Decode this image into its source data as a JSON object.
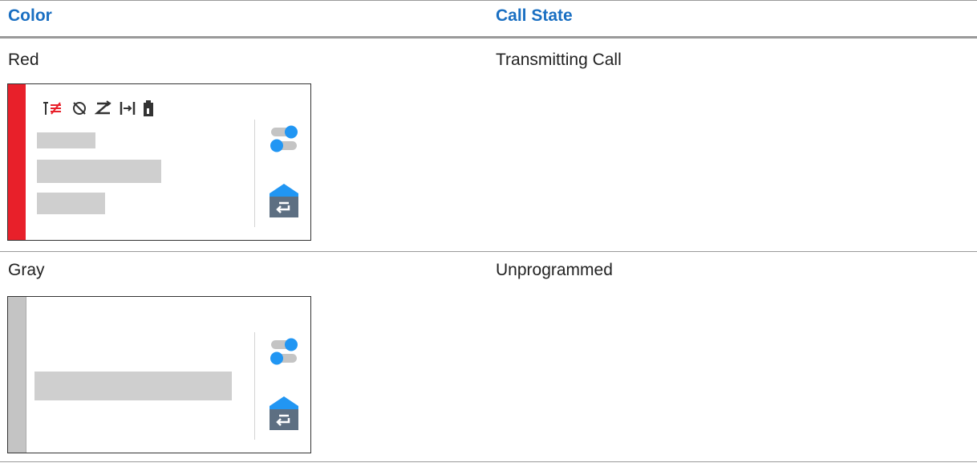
{
  "table": {
    "headers": [
      "Color",
      "Call State"
    ],
    "rows": [
      {
        "color": "Red",
        "call_state": "Transmitting Call",
        "bar_color": "#e8202a",
        "icons": [
          "antenna-transmit-icon",
          "no-gps-icon",
          "scan-icon",
          "talkaround-icon",
          "battery-icon",
          "toggle-icon",
          "home-back-icon"
        ]
      },
      {
        "color": "Gray",
        "call_state": "Unprogrammed",
        "bar_color": "#c4c4c4",
        "icons": [
          "toggle-icon",
          "home-back-icon"
        ]
      }
    ]
  },
  "colors": {
    "header_text": "#1a6fc2",
    "icon_blue": "#2196f3",
    "icon_slate": "#5d6f82",
    "placeholder_gray": "#cfcfcf"
  }
}
